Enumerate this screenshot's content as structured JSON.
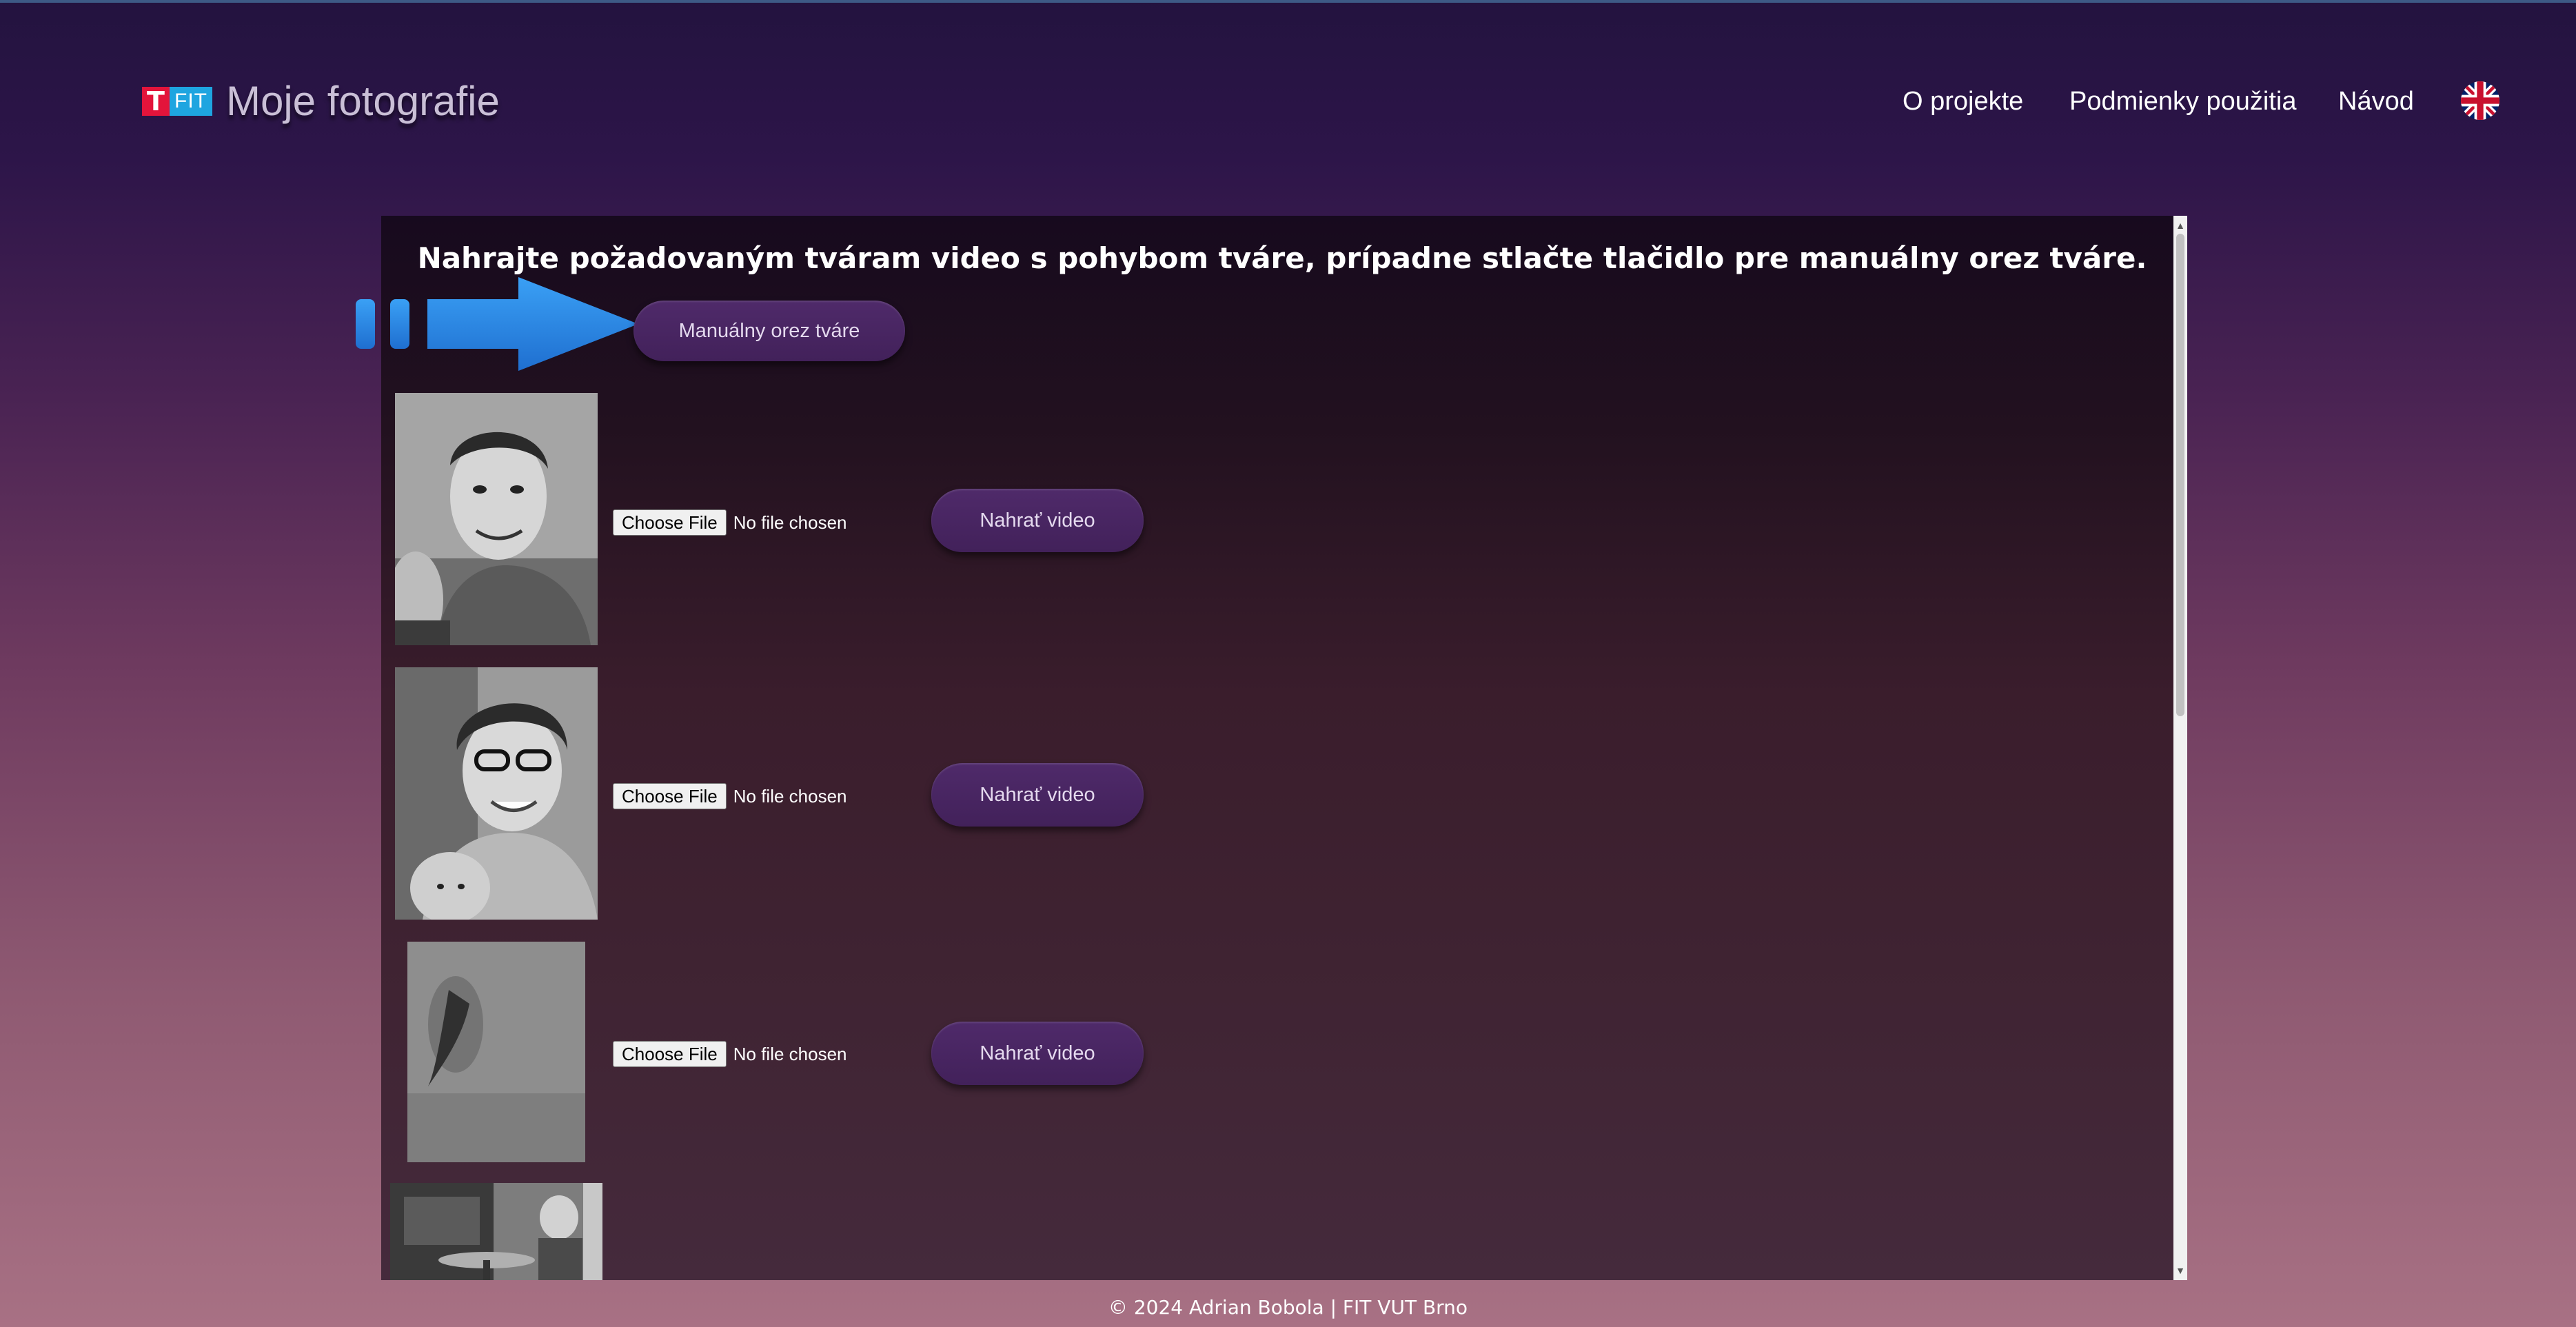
{
  "header": {
    "logo_t": "T",
    "logo_fit": "FIT",
    "title": "Moje fotografie",
    "nav": [
      {
        "label": "O projekte"
      },
      {
        "label": "Podmienky použitia"
      },
      {
        "label": "Návod"
      }
    ],
    "language_icon": "uk-flag-icon"
  },
  "main": {
    "heading": "Nahrajte požadovaným tváram video s pohybom tváre, prípadne stlačte tlačidlo pre manuálny orez tváre.",
    "manual_crop_button": "Manuálny orez tváre",
    "faces": [
      {
        "choose_label": "Choose File",
        "file_status": "No file chosen",
        "upload_label": "Nahrať video"
      },
      {
        "choose_label": "Choose File",
        "file_status": "No file chosen",
        "upload_label": "Nahrať video"
      },
      {
        "choose_label": "Choose File",
        "file_status": "No file chosen",
        "upload_label": "Nahrať video"
      }
    ]
  },
  "footer": {
    "text": "© 2024 Adrian Bobola | FIT VUT Brno"
  },
  "colors": {
    "accent_arrow": "#2b8ce6",
    "button_bg": "#4f2a6a",
    "logo_red": "#e3143b",
    "logo_blue": "#1ea5e0"
  }
}
